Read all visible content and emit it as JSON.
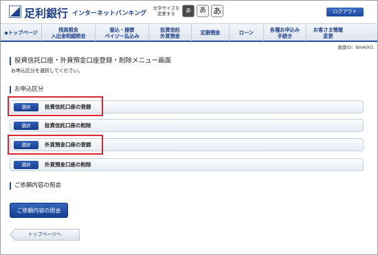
{
  "header": {
    "bank_name": "足利銀行",
    "bank_subtitle": "インターネットバンキング",
    "font_size_label_1": "文字サイズを",
    "font_size_label_2": "変更する",
    "font_sizes": [
      "あ",
      "あ",
      "あ"
    ],
    "logout_label": "ログアウト",
    "brand_color": "#1b3f8c"
  },
  "nav": {
    "items": [
      {
        "label": "◆トップページ"
      },
      {
        "label": "残高照会\n入出金明細照会"
      },
      {
        "label": "振込・振替\nペイジー払込み"
      },
      {
        "label": "投資信託\n外貨預金"
      },
      {
        "label": "定期預金"
      },
      {
        "label": "ローン"
      },
      {
        "label": "各種お申込み\n手続き"
      },
      {
        "label": "お客さま情報\n変更"
      }
    ]
  },
  "screen_id": "画面ID：BHA001",
  "page": {
    "title": "投資信託口座・外貨預金口座登録・削除メニュー画面",
    "description": "お申込区分を選択してください。"
  },
  "sections": {
    "application_type": "お申込区分",
    "inquiry": "ご依頼内容の照会"
  },
  "options": [
    {
      "button": "選択",
      "label": "投資信託口座の登録",
      "highlighted": true
    },
    {
      "button": "選択",
      "label": "投資信託口座の削除",
      "highlighted": false
    },
    {
      "button": "選択",
      "label": "外貨預金口座の登録",
      "highlighted": true
    },
    {
      "button": "選択",
      "label": "外貨預金口座の削除",
      "highlighted": false
    }
  ],
  "inquiry_button": "ご依頼内容の照会",
  "top_page_link": "トップページへ",
  "colors": {
    "accent": "#244f9e",
    "highlight": "#d9272e",
    "button": "#1b4aa0"
  }
}
